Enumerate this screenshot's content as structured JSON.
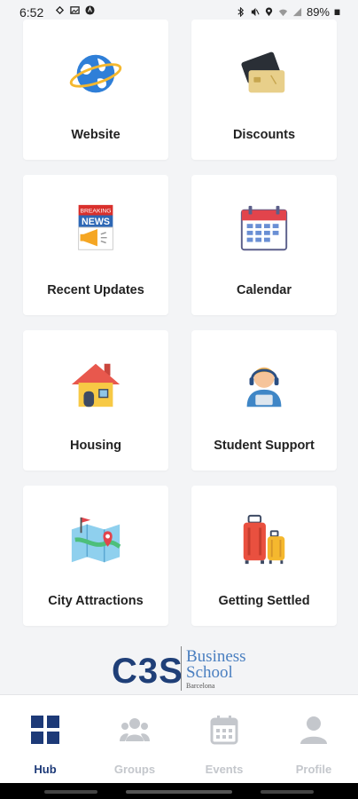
{
  "status": {
    "time": "6:52",
    "battery": "89%"
  },
  "tiles": [
    {
      "label": "Website",
      "icon": "globe-icon"
    },
    {
      "label": "Discounts",
      "icon": "cards-icon"
    },
    {
      "label": "Recent Updates",
      "icon": "breaking-news-icon",
      "icon_text_1": "BREAKING",
      "icon_text_2": "NEWS"
    },
    {
      "label": "Calendar",
      "icon": "calendar-icon"
    },
    {
      "label": "Housing",
      "icon": "house-icon"
    },
    {
      "label": "Student Support",
      "icon": "support-agent-icon"
    },
    {
      "label": "City Attractions",
      "icon": "map-icon"
    },
    {
      "label": "Getting Settled",
      "icon": "luggage-icon"
    }
  ],
  "logo": {
    "mark": "C3S",
    "line1": "Business",
    "line2": "School",
    "line3": "Barcelona"
  },
  "nav": [
    {
      "label": "Hub",
      "icon": "grid-icon",
      "active": true
    },
    {
      "label": "Groups",
      "icon": "group-icon",
      "active": false
    },
    {
      "label": "Events",
      "icon": "calendar-icon",
      "active": false
    },
    {
      "label": "Profile",
      "icon": "person-icon",
      "active": false
    }
  ],
  "colors": {
    "accent": "#1d3a78",
    "inactive": "#c4c7cc",
    "background": "#f3f4f6"
  }
}
